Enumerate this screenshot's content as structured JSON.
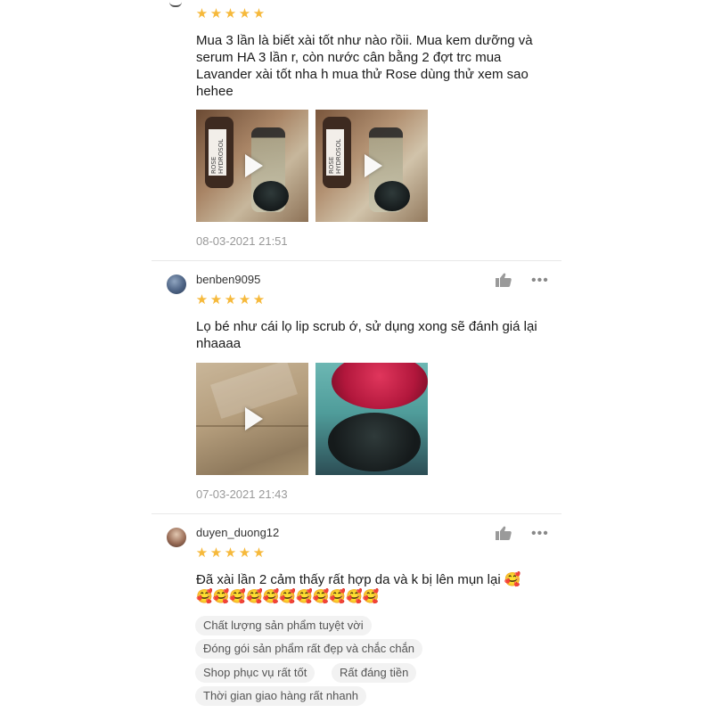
{
  "reviews": [
    {
      "username": "",
      "rating": 5,
      "comment": "Mua 3 lần là biết xài tốt như nào rồii. Mua kem dưỡng và serum HA 3 lần r, còn nước cân bằng 2 đợt trc mua Lavander xài tốt nha h mua thử Rose dùng thử xem sao hehee",
      "media": [
        {
          "type": "video",
          "label": "ROSE HYDROSOL"
        },
        {
          "type": "video",
          "label": "ROSE HYDROSOL"
        }
      ],
      "date": "08-03-2021 21:51"
    },
    {
      "username": "benben9095",
      "rating": 5,
      "comment": "Lọ bé như cái lọ lip scrub ớ, sử dụng xong sẽ đánh giá lại nhaaaa",
      "media": [
        {
          "type": "video"
        },
        {
          "type": "image"
        }
      ],
      "date": "07-03-2021 21:43"
    },
    {
      "username": "duyen_duong12",
      "rating": 5,
      "comment_line1": "Đã xài lần 2 cảm thấy rất hợp da và k bị lên mụn lại",
      "tags": [
        "Chất lượng sản phẩm tuyệt vời",
        "Đóng gói sản phẩm rất đẹp và chắc chắn",
        "Shop phục vụ rất tốt",
        "Rất đáng tiền",
        "Thời gian giao hàng rất nhanh"
      ]
    }
  ],
  "icons": {
    "star": "★",
    "like": "thumbs-up-icon",
    "more": "•••",
    "emoji": "smiling-face-with-hearts-icon"
  },
  "colors": {
    "star": "#f6b93b",
    "date": "#999999",
    "tag_bg": "#f2f2f2"
  }
}
